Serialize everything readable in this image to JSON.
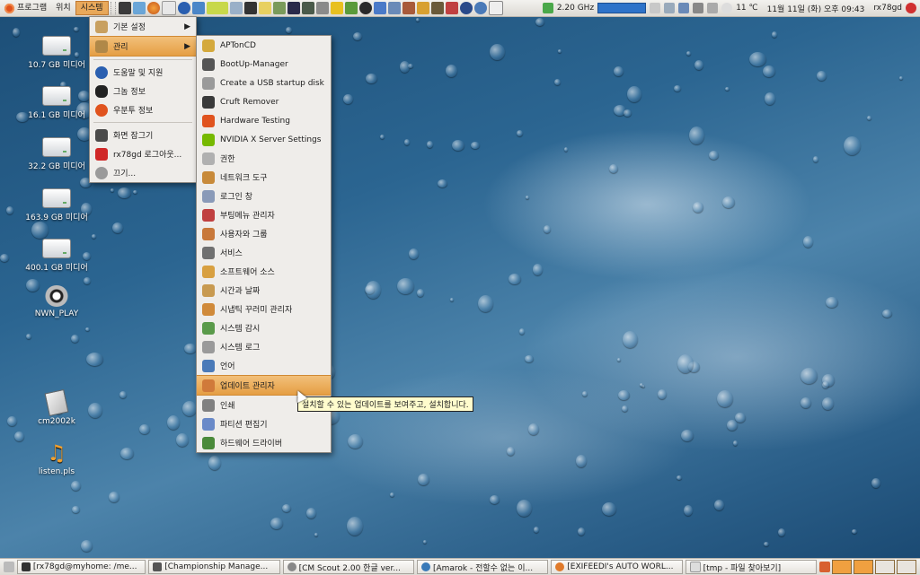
{
  "top_panel": {
    "menus": [
      "프로그램",
      "위치",
      "시스템"
    ],
    "cpu": "2.20 GHz",
    "temperature": "11 ℃",
    "clock": "11월 11일 (화) 오후 09:43",
    "user": "rx78gd"
  },
  "desktop_icons": [
    {
      "label": "10.7 GB 미디어",
      "kind": "drive"
    },
    {
      "label": "16.1 GB 미디어",
      "kind": "drive"
    },
    {
      "label": "32.2 GB 미디어",
      "kind": "drive"
    },
    {
      "label": "163.9 GB 미디어",
      "kind": "drive"
    },
    {
      "label": "400.1 GB 미디어",
      "kind": "drive"
    },
    {
      "label": "NWN_PLAY",
      "kind": "game"
    },
    {
      "label": "cm2002k",
      "kind": "document"
    },
    {
      "label": "listen.pls",
      "kind": "audio"
    }
  ],
  "system_menu": {
    "items": [
      {
        "label": "기본 설정",
        "icon": "preferences-icon",
        "submenu": true
      },
      {
        "label": "관리",
        "icon": "admin-tools-icon",
        "submenu": true,
        "highlighted": true
      },
      {
        "label": "도움말 및 지원",
        "icon": "help-icon"
      },
      {
        "label": "그놈 정보",
        "icon": "gnome-foot-icon"
      },
      {
        "label": "우분투 정보",
        "icon": "ubuntu-icon"
      },
      {
        "label": "화면 잠그기",
        "icon": "lock-screen-icon"
      },
      {
        "label": "rx78gd 로그아웃...",
        "icon": "logout-icon"
      },
      {
        "label": "끄기...",
        "icon": "shutdown-icon"
      }
    ]
  },
  "admin_menu": {
    "items": [
      {
        "label": "APTonCD",
        "icon": "cd-icon",
        "color": "#d4a93c"
      },
      {
        "label": "BootUp-Manager",
        "icon": "bootup-icon",
        "color": "#555555"
      },
      {
        "label": "Create a USB startup disk",
        "icon": "usb-icon",
        "color": "#9a9a9a"
      },
      {
        "label": "Cruft Remover",
        "icon": "window-icon",
        "color": "#3a3a3a"
      },
      {
        "label": "Hardware Testing",
        "icon": "ubuntu-icon",
        "color": "#e0531e"
      },
      {
        "label": "NVIDIA X Server Settings",
        "icon": "nvidia-icon",
        "color": "#76b900"
      },
      {
        "label": "권한",
        "icon": "keys-icon",
        "color": "#b0b0b0"
      },
      {
        "label": "네트워크 도구",
        "icon": "network-icon",
        "color": "#c88a3a"
      },
      {
        "label": "로그인 창",
        "icon": "login-icon",
        "color": "#8a9ab8"
      },
      {
        "label": "부팅메뉴 관리자",
        "icon": "bootmenu-icon",
        "color": "#c04040"
      },
      {
        "label": "사용자와 그룹",
        "icon": "users-icon",
        "color": "#c8783a"
      },
      {
        "label": "서비스",
        "icon": "services-icon",
        "color": "#707070"
      },
      {
        "label": "소프트웨어 소스",
        "icon": "software-sources-icon",
        "color": "#d8a040"
      },
      {
        "label": "시간과 날짜",
        "icon": "clock-icon",
        "color": "#c89a50"
      },
      {
        "label": "시냅틱 꾸러미 관리자",
        "icon": "synaptic-icon",
        "color": "#d08a3a"
      },
      {
        "label": "시스템 감시",
        "icon": "monitor-icon",
        "color": "#5a9a4a"
      },
      {
        "label": "시스템 로그",
        "icon": "log-icon",
        "color": "#9a9a9a"
      },
      {
        "label": "언어",
        "icon": "language-icon",
        "color": "#4a7ab8"
      },
      {
        "label": "업데이트 관리자",
        "icon": "update-icon",
        "color": "#d07a3a",
        "highlighted": true
      },
      {
        "label": "인쇄",
        "icon": "printer-icon",
        "color": "#808080"
      },
      {
        "label": "파티션 편집기",
        "icon": "partition-icon",
        "color": "#6a8ac8"
      },
      {
        "label": "하드웨어 드라이버",
        "icon": "hardware-icon",
        "color": "#4a8a3a"
      }
    ]
  },
  "tooltip": "설치할 수 있는 업데이트를 보여주고, 설치합니다.",
  "taskbar": [
    "[rx78gd@myhome: /me...",
    "[Championship Manage...",
    "[CM Scout 2.00 한글 ver...",
    "[Amarok - 전할수 없는 이...",
    "[EXIFEEDI's AUTO WORL...",
    "[tmp - 파일 찾아보기]"
  ]
}
